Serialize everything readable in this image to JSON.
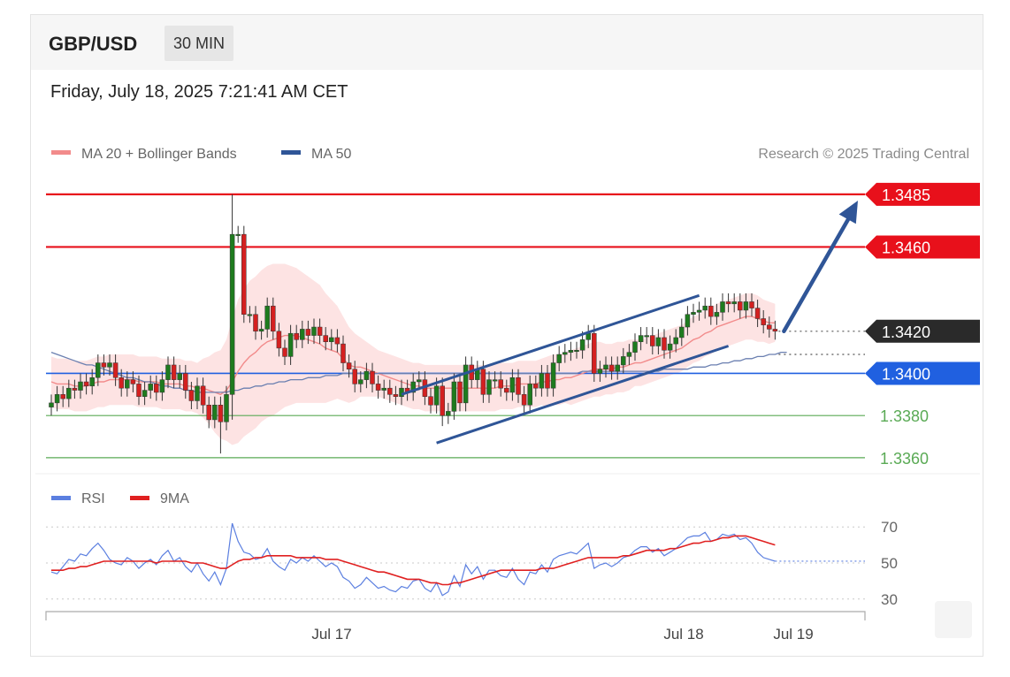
{
  "header": {
    "symbol": "GBP/USD",
    "timeframe": "30 MIN"
  },
  "timestamp": "Friday, July 18, 2025 7:21:41 AM CET",
  "legend": {
    "main": [
      {
        "label": "MA 20 + Bollinger Bands",
        "color": "#f28b8b"
      },
      {
        "label": "MA 50",
        "color": "#2f5597"
      }
    ],
    "rsi": [
      {
        "label": "RSI",
        "color": "#5b7fe0"
      },
      {
        "label": "9MA",
        "color": "#e02020"
      }
    ],
    "credit": "Research © 2025 Trading Central"
  },
  "colors": {
    "resistance": "#e8101b",
    "pivot": "#2060e0",
    "support": "#5aaa55",
    "last": "#2a2a2a",
    "bull": "#1e7b1e",
    "bear": "#d42020",
    "channel": "#2f5597"
  },
  "chart_data": [
    {
      "type": "candlestick",
      "symbol": "GBP/USD",
      "interval": "30 MIN",
      "ylim": [
        1.3357,
        1.3495
      ],
      "x_ticks": [
        "Jul 17",
        "Jul 18",
        "Jul 19"
      ],
      "levels": [
        {
          "value": 1.3485,
          "label": "1.3485",
          "kind": "resistance"
        },
        {
          "value": 1.346,
          "label": "1.3460",
          "kind": "resistance"
        },
        {
          "value": 1.342,
          "label": "1.3420",
          "kind": "last"
        },
        {
          "value": 1.34,
          "label": "1.3400",
          "kind": "pivot"
        },
        {
          "value": 1.338,
          "label": "1.3380",
          "kind": "support"
        },
        {
          "value": 1.336,
          "label": "1.3360",
          "kind": "support"
        }
      ],
      "closes": [
        1.3386,
        1.339,
        1.3388,
        1.3393,
        1.3392,
        1.3396,
        1.3394,
        1.3398,
        1.3405,
        1.3403,
        1.3405,
        1.3398,
        1.3393,
        1.3397,
        1.3395,
        1.3389,
        1.3392,
        1.3395,
        1.3391,
        1.3397,
        1.3404,
        1.3397,
        1.34,
        1.3392,
        1.3387,
        1.3394,
        1.3385,
        1.3378,
        1.3385,
        1.3377,
        1.339,
        1.3466,
        1.3466,
        1.3428,
        1.3428,
        1.342,
        1.3421,
        1.3432,
        1.342,
        1.3412,
        1.3408,
        1.3419,
        1.3416,
        1.3421,
        1.3418,
        1.3422,
        1.3418,
        1.3415,
        1.3417,
        1.3414,
        1.3405,
        1.3402,
        1.3395,
        1.3397,
        1.3401,
        1.3395,
        1.3392,
        1.3393,
        1.339,
        1.3389,
        1.3393,
        1.3391,
        1.3396,
        1.3397,
        1.3389,
        1.3385,
        1.3394,
        1.338,
        1.3382,
        1.3396,
        1.3386,
        1.3404,
        1.3397,
        1.3402,
        1.339,
        1.3397,
        1.3397,
        1.3393,
        1.3391,
        1.3398,
        1.339,
        1.3385,
        1.3395,
        1.3393,
        1.34,
        1.3393,
        1.3405,
        1.3409,
        1.341,
        1.3411,
        1.3411,
        1.3416,
        1.3419,
        1.34,
        1.3402,
        1.3404,
        1.3401,
        1.3404,
        1.3408,
        1.341,
        1.3415,
        1.3418,
        1.3418,
        1.3413,
        1.3417,
        1.3411,
        1.3414,
        1.3417,
        1.3422,
        1.3428,
        1.3429,
        1.343,
        1.3432,
        1.3427,
        1.3429,
        1.3434,
        1.3433,
        1.3434,
        1.343,
        1.3434,
        1.3431,
        1.3426,
        1.3423,
        1.3421,
        1.342
      ],
      "ma20": [
        1.3396,
        1.3395,
        1.3395,
        1.3395,
        1.3394,
        1.3394,
        1.3394,
        1.3395,
        1.3396,
        1.3396,
        1.3397,
        1.3397,
        1.3397,
        1.3397,
        1.3397,
        1.3396,
        1.3396,
        1.3396,
        1.3396,
        1.3395,
        1.3395,
        1.3395,
        1.3395,
        1.3394,
        1.3394,
        1.3393,
        1.3393,
        1.3392,
        1.3391,
        1.339,
        1.3392,
        1.3396,
        1.3401,
        1.3405,
        1.3408,
        1.341,
        1.3413,
        1.3415,
        1.3416,
        1.3417,
        1.3418,
        1.3418,
        1.3418,
        1.3417,
        1.3416,
        1.3415,
        1.3414,
        1.3412,
        1.3411,
        1.341,
        1.3407,
        1.3404,
        1.3403,
        1.3403,
        1.3402,
        1.3401,
        1.34,
        1.3399,
        1.3398,
        1.3397,
        1.3396,
        1.3395,
        1.3394,
        1.3394,
        1.3393,
        1.3393,
        1.3393,
        1.3393,
        1.3393,
        1.3393,
        1.3393,
        1.3393,
        1.3393,
        1.3393,
        1.3393,
        1.3393,
        1.3393,
        1.3394,
        1.3394,
        1.3394,
        1.3395,
        1.3395,
        1.3395,
        1.3395,
        1.3396,
        1.3396,
        1.3397,
        1.3397,
        1.3398,
        1.3398,
        1.3399,
        1.34,
        1.3401,
        1.3402,
        1.3402,
        1.3402,
        1.3402,
        1.3403,
        1.3403,
        1.3404,
        1.3405,
        1.3405,
        1.3406,
        1.3407,
        1.3408,
        1.3409,
        1.341,
        1.3411,
        1.3412,
        1.3414,
        1.3416,
        1.3417,
        1.3419,
        1.342,
        1.3422,
        1.3423,
        1.3424,
        1.3425,
        1.3426,
        1.3427,
        1.3427,
        1.3426,
        1.3425,
        1.3424,
        1.3424
      ],
      "band_width": [
        0.0012,
        0.0012,
        0.0012,
        0.0012,
        0.0012,
        0.0012,
        0.0012,
        0.0012,
        0.0012,
        0.0012,
        0.0012,
        0.0012,
        0.0012,
        0.0012,
        0.0012,
        0.0012,
        0.0012,
        0.0012,
        0.0012,
        0.0012,
        0.0012,
        0.0012,
        0.0012,
        0.0012,
        0.0012,
        0.0012,
        0.0014,
        0.0016,
        0.0019,
        0.0021,
        0.0024,
        0.003,
        0.0034,
        0.0035,
        0.0036,
        0.0036,
        0.0036,
        0.0036,
        0.0036,
        0.0035,
        0.0034,
        0.0033,
        0.0032,
        0.0031,
        0.003,
        0.0029,
        0.0028,
        0.0026,
        0.0024,
        0.0022,
        0.002,
        0.0018,
        0.0016,
        0.0014,
        0.0013,
        0.0012,
        0.0011,
        0.0011,
        0.0011,
        0.0011,
        0.0011,
        0.0011,
        0.0011,
        0.0011,
        0.0011,
        0.0011,
        0.0011,
        0.0011,
        0.0011,
        0.0011,
        0.0011,
        0.0011,
        0.0011,
        0.0011,
        0.0011,
        0.0011,
        0.0011,
        0.0011,
        0.0011,
        0.0011,
        0.0011,
        0.0011,
        0.0011,
        0.0011,
        0.0011,
        0.0012,
        0.0012,
        0.0012,
        0.0012,
        0.0013,
        0.0013,
        0.0013,
        0.0013,
        0.0013,
        0.0013,
        0.0012,
        0.0012,
        0.0012,
        0.0012,
        0.0012,
        0.0011,
        0.0011,
        0.0011,
        0.0011,
        0.0011,
        0.0011,
        0.0011,
        0.0011,
        0.0011,
        0.0011,
        0.0011,
        0.0011,
        0.0011,
        0.0011,
        0.0011,
        0.0011,
        0.0011,
        0.0011,
        0.0011,
        0.0011,
        0.0011,
        0.0011,
        0.001,
        0.001,
        0.0009,
        0.0009,
        0.0009
      ],
      "ma50": [
        1.341,
        1.3409,
        1.3408,
        1.3407,
        1.3406,
        1.3405,
        1.3404,
        1.3404,
        1.3403,
        1.3402,
        1.3401,
        1.34,
        1.3399,
        1.3398,
        1.3398,
        1.3397,
        1.3396,
        1.3396,
        1.3395,
        1.3394,
        1.3394,
        1.3393,
        1.3393,
        1.3392,
        1.3392,
        1.3391,
        1.3391,
        1.3391,
        1.3391,
        1.3391,
        1.3391,
        1.3392,
        1.3392,
        1.3393,
        1.3393,
        1.3394,
        1.3394,
        1.3395,
        1.3395,
        1.3396,
        1.3396,
        1.3397,
        1.3397,
        1.3397,
        1.3398,
        1.3398,
        1.3398,
        1.3399,
        1.3399,
        1.3399,
        1.34,
        1.34,
        1.34,
        1.34,
        1.34,
        1.34,
        1.34,
        1.34,
        1.34,
        1.34,
        1.34,
        1.34,
        1.34,
        1.34,
        1.34,
        1.34,
        1.34,
        1.34,
        1.34,
        1.34,
        1.34,
        1.34,
        1.34,
        1.34,
        1.34,
        1.34,
        1.34,
        1.34,
        1.34,
        1.34,
        1.34,
        1.34,
        1.34,
        1.34,
        1.34,
        1.34,
        1.34,
        1.34,
        1.34,
        1.34,
        1.34,
        1.3401,
        1.3401,
        1.3401,
        1.3401,
        1.3401,
        1.3401,
        1.3401,
        1.3401,
        1.3401,
        1.3401,
        1.3401,
        1.3401,
        1.3401,
        1.3401,
        1.3402,
        1.3402,
        1.3402,
        1.3402,
        1.3402,
        1.3403,
        1.3403,
        1.3403,
        1.3404,
        1.3404,
        1.3405,
        1.3405,
        1.3406,
        1.3406,
        1.3407,
        1.3407,
        1.3408,
        1.3408,
        1.3409,
        1.3409,
        1.341,
        1.341
      ],
      "channel": {
        "upper": [
          [
            1.339,
            1.3437
          ]
        ],
        "lower": [
          [
            1.3367,
            1.3413
          ]
        ]
      },
      "forecast_arrow": {
        "from": 1.342,
        "to": 1.3482
      }
    },
    {
      "type": "line",
      "name": "RSI",
      "ylim": [
        25,
        75
      ],
      "y_ticks": [
        70,
        50,
        30
      ],
      "series": [
        {
          "name": "RSI",
          "values": [
            45,
            44,
            48,
            52,
            51,
            55,
            54,
            58,
            61,
            57,
            52,
            50,
            49,
            53,
            51,
            47,
            50,
            52,
            49,
            54,
            57,
            51,
            53,
            48,
            45,
            50,
            44,
            40,
            45,
            38,
            47,
            72,
            62,
            56,
            55,
            52,
            53,
            58,
            51,
            48,
            46,
            52,
            50,
            53,
            51,
            54,
            51,
            48,
            50,
            48,
            42,
            40,
            36,
            38,
            42,
            39,
            36,
            37,
            35,
            34,
            37,
            36,
            40,
            41,
            36,
            34,
            39,
            32,
            34,
            43,
            37,
            49,
            44,
            48,
            41,
            46,
            46,
            43,
            42,
            47,
            41,
            38,
            45,
            44,
            49,
            45,
            52,
            54,
            55,
            56,
            55,
            58,
            61,
            47,
            49,
            50,
            48,
            50,
            53,
            54,
            57,
            59,
            59,
            56,
            58,
            54,
            56,
            58,
            61,
            64,
            65,
            65,
            67,
            62,
            63,
            66,
            65,
            66,
            63,
            64,
            61,
            56,
            53,
            52,
            51
          ]
        },
        {
          "name": "9MA",
          "values": [
            46,
            46,
            46,
            47,
            47,
            48,
            48,
            49,
            50,
            51,
            51,
            51,
            51,
            51,
            51,
            51,
            51,
            51,
            50,
            51,
            51,
            51,
            51,
            51,
            50,
            50,
            50,
            49,
            48,
            47,
            47,
            49,
            51,
            52,
            52,
            53,
            53,
            54,
            54,
            54,
            54,
            54,
            53,
            53,
            53,
            53,
            53,
            52,
            52,
            52,
            51,
            50,
            49,
            48,
            47,
            46,
            45,
            45,
            44,
            43,
            42,
            41,
            41,
            41,
            40,
            39,
            39,
            38,
            38,
            39,
            39,
            40,
            41,
            42,
            43,
            44,
            45,
            46,
            46,
            46,
            46,
            46,
            46,
            46,
            47,
            47,
            47,
            48,
            49,
            50,
            51,
            52,
            53,
            53,
            53,
            53,
            53,
            53,
            54,
            54,
            55,
            56,
            57,
            57,
            57,
            57,
            58,
            58,
            59,
            60,
            61,
            61,
            62,
            62,
            63,
            64,
            64,
            65,
            65,
            65,
            64,
            63,
            62,
            61,
            60
          ]
        }
      ]
    }
  ]
}
